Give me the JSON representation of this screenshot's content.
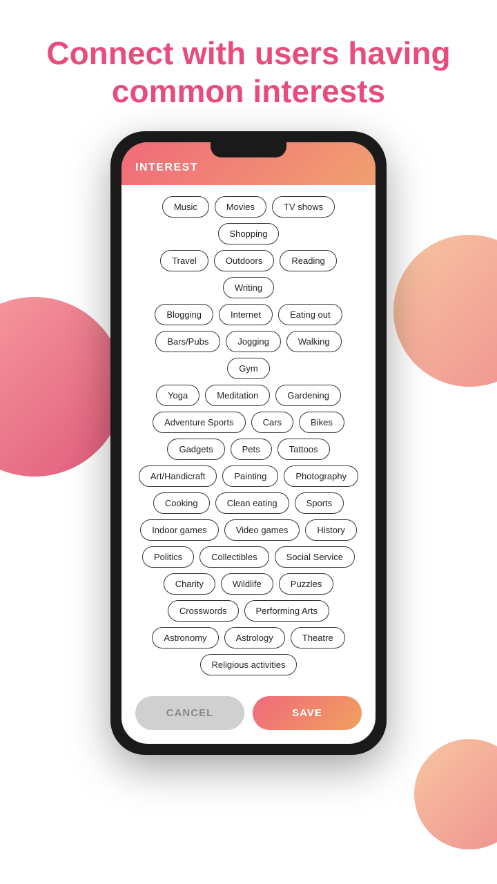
{
  "heading": {
    "line1": "Connect with users having",
    "line2": "common interests"
  },
  "app": {
    "header_title": "INTEREST",
    "cancel_label": "CANCEL",
    "save_label": "SAVE"
  },
  "interest_rows": [
    [
      "Music",
      "Movies",
      "TV shows",
      "Shopping"
    ],
    [
      "Travel",
      "Outdoors",
      "Reading",
      "Writing"
    ],
    [
      "Blogging",
      "Internet",
      "Eating out"
    ],
    [
      "Bars/Pubs",
      "Jogging",
      "Walking",
      "Gym"
    ],
    [
      "Yoga",
      "Meditation",
      "Gardening"
    ],
    [
      "Adventure Sports",
      "Cars",
      "Bikes"
    ],
    [
      "Gadgets",
      "Pets",
      "Tattoos"
    ],
    [
      "Art/Handicraft",
      "Painting",
      "Photography"
    ],
    [
      "Cooking",
      "Clean eating",
      "Sports"
    ],
    [
      "Indoor games",
      "Video games",
      "History"
    ],
    [
      "Politics",
      "Collectibles",
      "Social Service"
    ],
    [
      "Charity",
      "Wildlife",
      "Puzzles"
    ],
    [
      "Crosswords",
      "Performing Arts"
    ],
    [
      "Astronomy",
      "Astrology",
      "Theatre"
    ],
    [
      "Religious activities"
    ]
  ]
}
